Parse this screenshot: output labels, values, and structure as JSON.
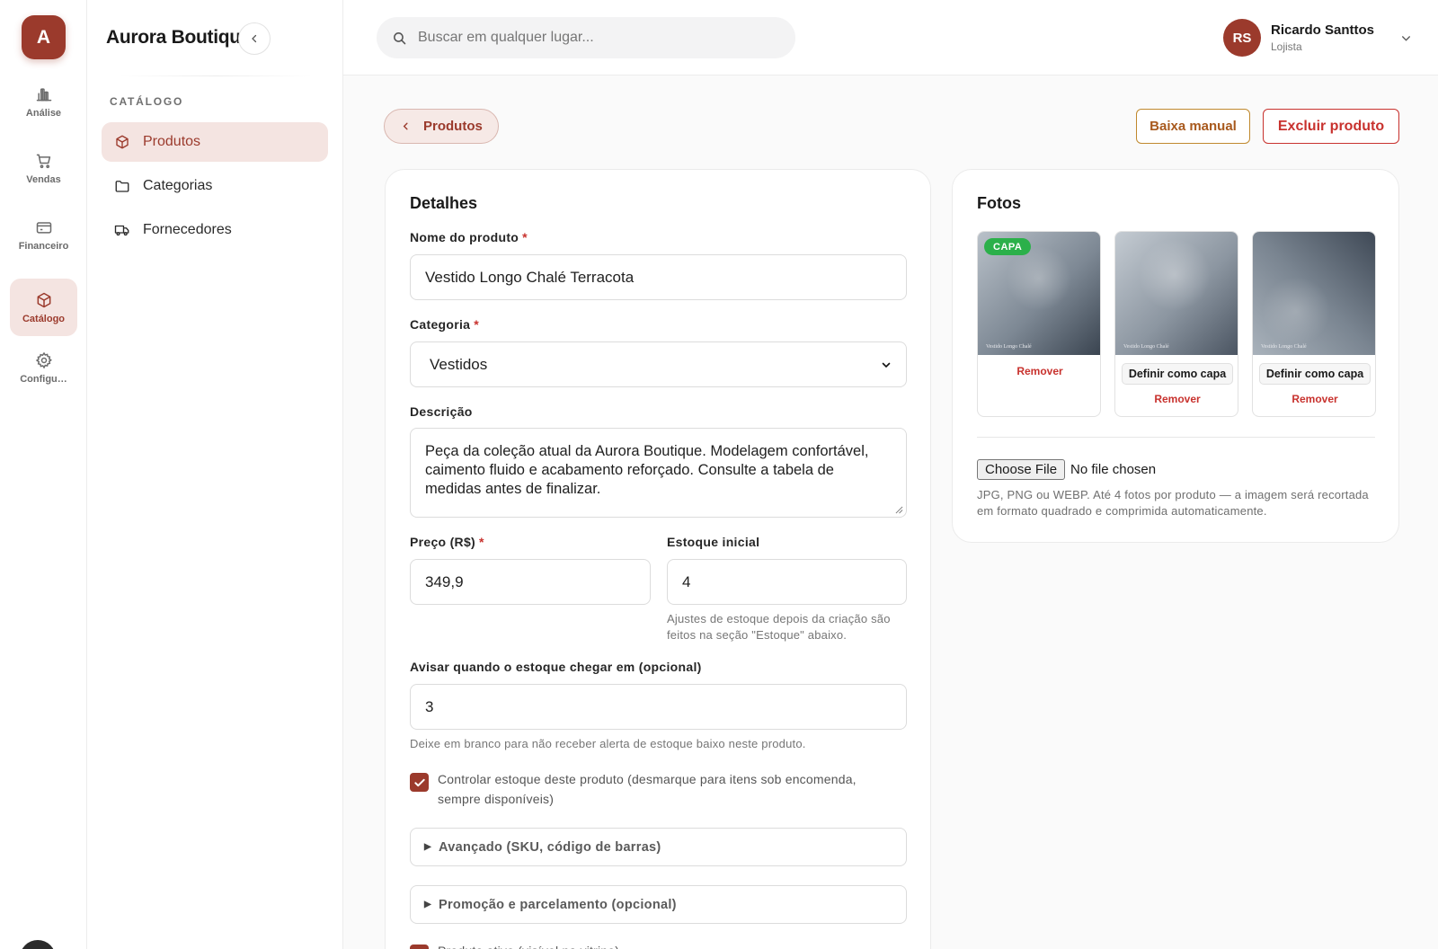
{
  "brand": {
    "initial": "A",
    "name": "Aurora Boutique",
    "accent": "#9b3a2c"
  },
  "rail": [
    {
      "label": "Análise",
      "icon": "bar-chart-icon"
    },
    {
      "label": "Vendas",
      "icon": "cart-icon"
    },
    {
      "label": "Financeiro",
      "icon": "credit-card-icon"
    },
    {
      "label": "Catálogo",
      "icon": "box-icon",
      "active": true
    },
    {
      "label": "Configu…",
      "icon": "gear-icon"
    }
  ],
  "sidebar": {
    "section": "CATÁLOGO",
    "items": [
      {
        "label": "Produtos",
        "icon": "box-icon",
        "active": true
      },
      {
        "label": "Categorias",
        "icon": "folder-icon"
      },
      {
        "label": "Fornecedores",
        "icon": "truck-icon"
      }
    ]
  },
  "search": {
    "placeholder": "Buscar em qualquer lugar..."
  },
  "user": {
    "initials": "RS",
    "name": "Ricardo Santtos",
    "role": "Lojista"
  },
  "actions": {
    "back": "Produtos",
    "manual": "Baixa manual",
    "delete": "Excluir produto"
  },
  "details": {
    "title": "Detalhes",
    "name_label": "Nome do produto",
    "name_value": "Vestido Longo Chalé Terracota",
    "category_label": "Categoria",
    "category_value": "Vestidos",
    "description_label": "Descrição",
    "description_value": "Peça da coleção atual da Aurora Boutique. Modelagem confortável, caimento fluido e acabamento reforçado. Consulte a tabela de medidas antes de finalizar.",
    "price_label": "Preço (R$)",
    "price_value": "349,9",
    "stock_label": "Estoque inicial",
    "stock_value": "4",
    "stock_hint": "Ajustes de estoque depois da criação são feitos na seção \"Estoque\" abaixo.",
    "alert_label": "Avisar quando o estoque chegar em (opcional)",
    "alert_value": "3",
    "alert_hint": "Deixe em branco para não receber alerta de estoque baixo neste produto.",
    "track_stock_label": "Controlar estoque deste produto (desmarque para itens sob encomenda, sempre disponíveis)",
    "track_stock_checked": true,
    "advanced_label": "Avançado (SKU, código de barras)",
    "promo_label": "Promoção e parcelamento (opcional)",
    "active_label": "Produto ativo (visível na vitrine)",
    "active_checked": true,
    "required_mark": "*"
  },
  "photos": {
    "title": "Fotos",
    "cover_badge": "CAPA",
    "caption": "Vestido Longo Chalé",
    "set_cover": "Definir como capa",
    "remove": "Remover",
    "file_button": "Choose File",
    "file_status": "No file chosen",
    "note": "JPG, PNG ou WEBP. Até 4 fotos por produto — a imagem será recortada em formato quadrado e comprimida automaticamente."
  }
}
